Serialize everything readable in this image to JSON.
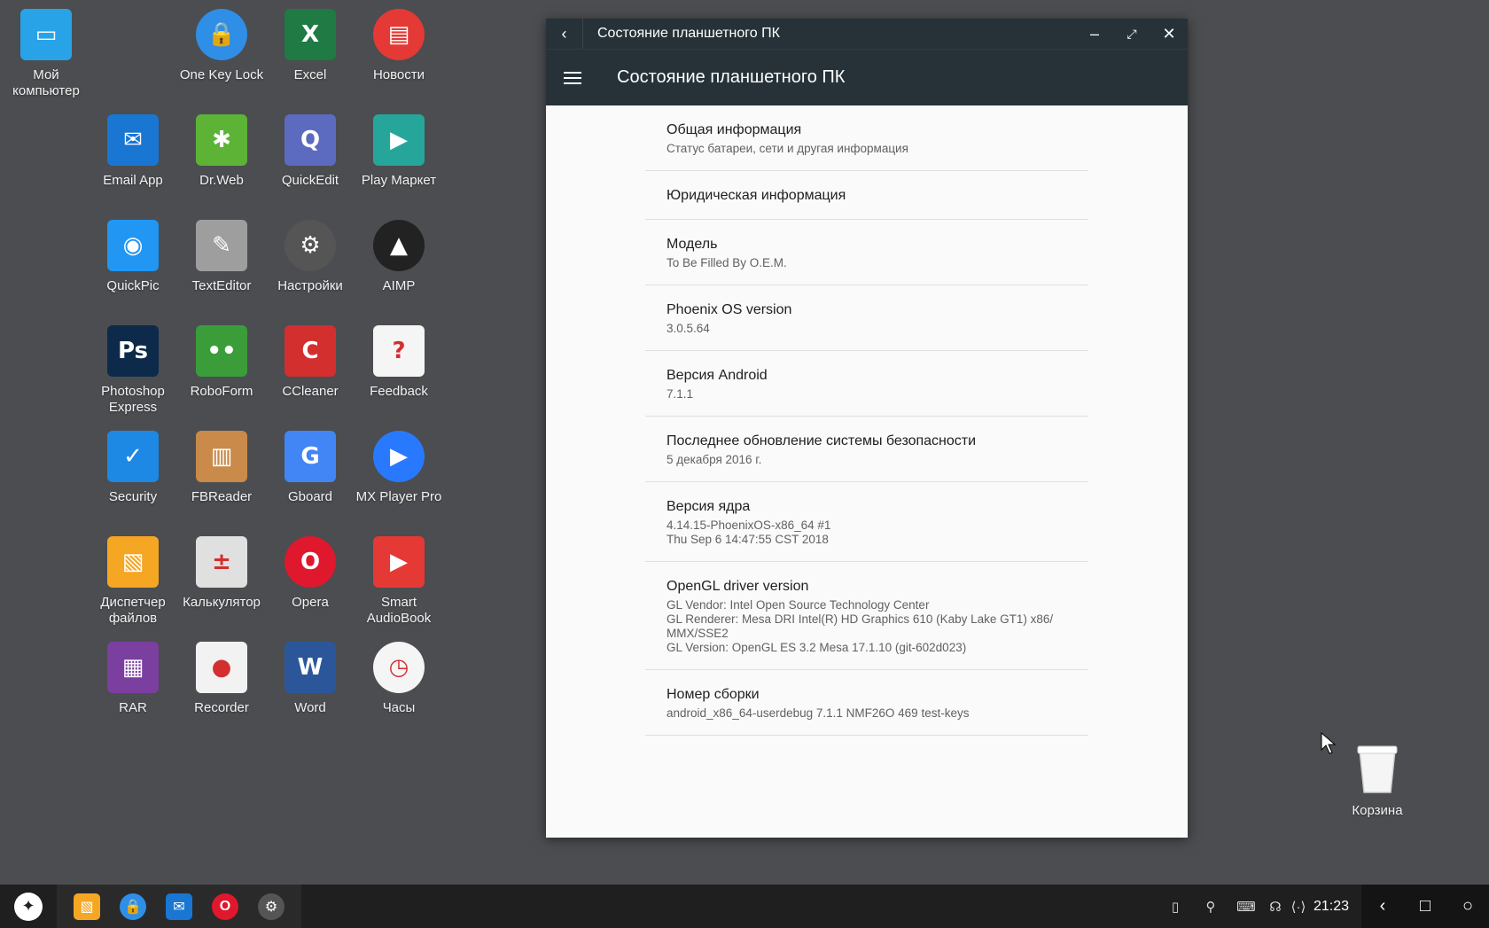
{
  "desktop": {
    "icons": [
      {
        "label": "Мой\nкомпьютер",
        "glyph": "▭",
        "icon": "computer-icon",
        "color": "#29a3e8"
      },
      {
        "label": "One Key Lock",
        "glyph": "🔒",
        "icon": "lock-icon",
        "color": "#2f8ee6"
      },
      {
        "label": "Excel",
        "glyph": "X",
        "icon": "excel-icon",
        "color": "#1f7a43"
      },
      {
        "label": "Новости",
        "glyph": "▤",
        "icon": "news-icon",
        "color": "#e53935"
      },
      {
        "label": "Email App",
        "glyph": "✉",
        "icon": "email-icon",
        "color": "#1976d2"
      },
      {
        "label": "Dr.Web",
        "glyph": "✱",
        "icon": "drweb-icon",
        "color": "#5cb336"
      },
      {
        "label": "QuickEdit",
        "glyph": "Q",
        "icon": "quickedit-icon",
        "color": "#5c6bc0"
      },
      {
        "label": "Play Маркет",
        "glyph": "▶",
        "icon": "play-market-icon",
        "color": "#26a69a"
      },
      {
        "label": "QuickPic",
        "glyph": "◉",
        "icon": "quickpic-icon",
        "color": "#2196f3"
      },
      {
        "label": "TextEditor",
        "glyph": "✎",
        "icon": "text-editor-icon",
        "color": "#9e9e9e"
      },
      {
        "label": "Настройки",
        "glyph": "⚙",
        "icon": "settings-icon",
        "color": "#555555"
      },
      {
        "label": "AIMP",
        "glyph": "▲",
        "icon": "aimp-icon",
        "color": "#222222"
      },
      {
        "label": "Photoshop\nExpress",
        "glyph": "Ps",
        "icon": "photoshop-icon",
        "color": "#0d2a4a"
      },
      {
        "label": "RoboForm",
        "glyph": "••",
        "icon": "roboform-icon",
        "color": "#3a9d3a"
      },
      {
        "label": "CCleaner",
        "glyph": "C",
        "icon": "ccleaner-icon",
        "color": "#d32f2f"
      },
      {
        "label": "Feedback",
        "glyph": "?",
        "icon": "feedback-icon",
        "color": "#f5f5f5"
      },
      {
        "label": "Security",
        "glyph": "✓",
        "icon": "shield-icon",
        "color": "#1e88e5"
      },
      {
        "label": "FBReader",
        "glyph": "▥",
        "icon": "fbreader-icon",
        "color": "#c98a4a"
      },
      {
        "label": "Gboard",
        "glyph": "G",
        "icon": "gboard-icon",
        "color": "#4285f4"
      },
      {
        "label": "MX Player Pro",
        "glyph": "▶",
        "icon": "mx-player-icon",
        "color": "#2979ff"
      },
      {
        "label": "Диспетчер\nфайлов",
        "glyph": "▧",
        "icon": "file-manager-icon",
        "color": "#f5a623"
      },
      {
        "label": "Калькулятор",
        "glyph": "±",
        "icon": "calculator-icon",
        "color": "#e0e0e0"
      },
      {
        "label": "Opera",
        "glyph": "O",
        "icon": "opera-icon",
        "color": "#e0182d"
      },
      {
        "label": "Smart\nAudioBook",
        "glyph": "▶",
        "icon": "audiobook-icon",
        "color": "#e53935"
      },
      {
        "label": "RAR",
        "glyph": "▦",
        "icon": "rar-icon",
        "color": "#7b3fa0"
      },
      {
        "label": "Recorder",
        "glyph": "●",
        "icon": "recorder-icon",
        "color": "#f2f2f2"
      },
      {
        "label": "Word",
        "glyph": "W",
        "icon": "word-icon",
        "color": "#2b579a"
      },
      {
        "label": "Часы",
        "glyph": "◷",
        "icon": "clock-icon",
        "color": "#f5f5f5"
      }
    ],
    "trash": {
      "label": "Корзина",
      "icon": "trash-icon"
    }
  },
  "window": {
    "title": "Состояние планшетного ПК",
    "appbar_title": "Состояние планшетного ПК",
    "items": [
      {
        "title": "Общая информация",
        "summary": "Статус батареи, сети и другая информация"
      },
      {
        "title": "Юридическая информация",
        "summary": ""
      },
      {
        "title": "Модель",
        "summary": "To Be Filled By O.E.M."
      },
      {
        "title": "Phoenix OS version",
        "summary": "3.0.5.64"
      },
      {
        "title": "Версия Android",
        "summary": "7.1.1"
      },
      {
        "title": "Последнее обновление системы безопасности",
        "summary": "5 декабря 2016 г."
      },
      {
        "title": "Версия ядра",
        "summary": "4.14.15-PhoenixOS-x86_64 #1\nThu Sep 6 14:47:55 CST 2018"
      },
      {
        "title": "OpenGL driver version",
        "summary": "GL Vendor: Intel Open Source Technology Center\nGL Renderer: Mesa DRI Intel(R) HD Graphics 610 (Kaby Lake GT1) x86/\nMMX/SSE2\nGL Version: OpenGL ES 3.2 Mesa 17.1.10 (git-602d023)"
      },
      {
        "title": "Номер сборки",
        "summary": "android_x86_64-userdebug 7.1.1 NMF26O 469 test-keys"
      }
    ]
  },
  "taskbar": {
    "apps": [
      {
        "icon": "file-manager-icon",
        "glyph": "▧",
        "color": "#f5a623"
      },
      {
        "icon": "lock-icon",
        "glyph": "🔒",
        "color": "#2f8ee6"
      },
      {
        "icon": "email-icon",
        "glyph": "✉",
        "color": "#1976d2"
      },
      {
        "icon": "opera-icon",
        "glyph": "O",
        "color": "#e0182d"
      },
      {
        "icon": "settings-icon",
        "glyph": "⚙",
        "color": "#555555"
      }
    ],
    "clock": "21:23"
  }
}
